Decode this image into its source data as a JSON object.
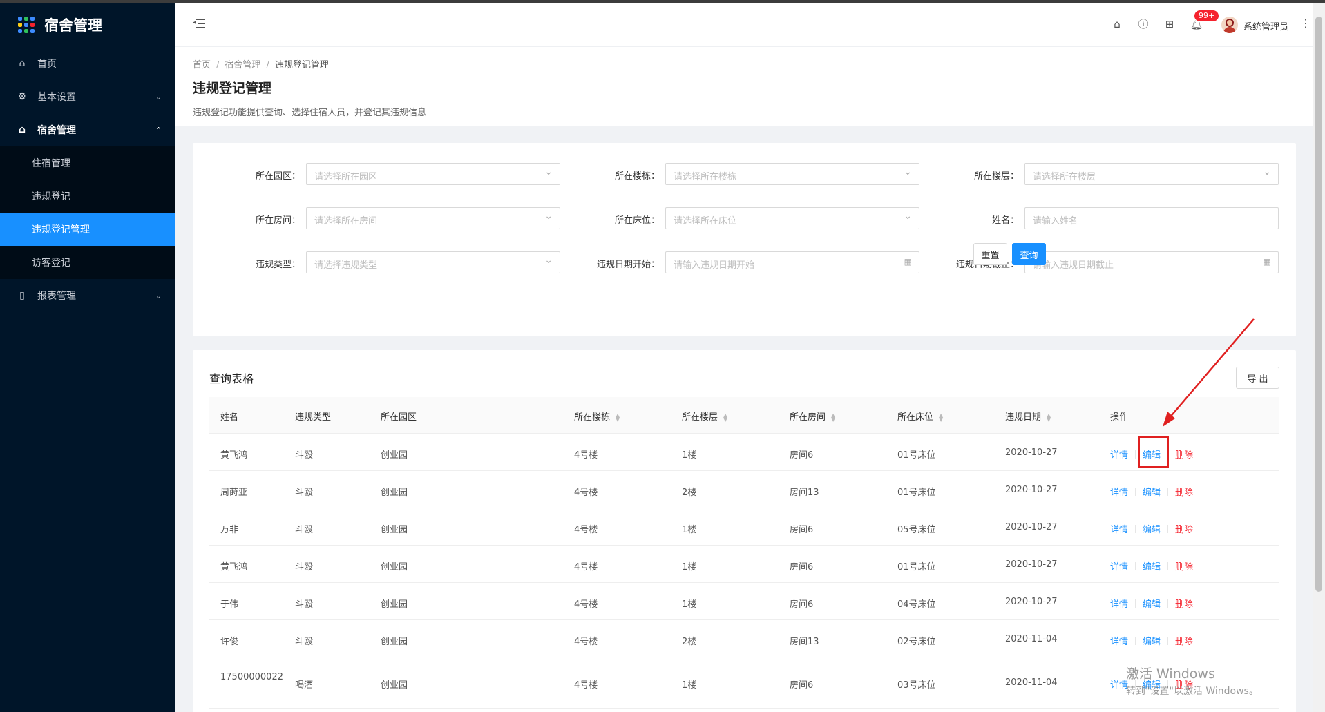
{
  "app": {
    "title": "宿舍管理"
  },
  "sidebar": {
    "items": [
      {
        "label": "首页",
        "icon": "home-icon"
      },
      {
        "label": "基本设置",
        "icon": "gear-icon"
      },
      {
        "label": "宿舍管理",
        "icon": "home-icon",
        "children": [
          {
            "label": "住宿管理"
          },
          {
            "label": "违规登记"
          },
          {
            "label": "违规登记管理",
            "active": true
          },
          {
            "label": "访客登记"
          }
        ]
      },
      {
        "label": "报表管理",
        "icon": "document-icon"
      }
    ]
  },
  "header": {
    "notification_count": "99+",
    "username": "系统管理员"
  },
  "breadcrumb": [
    "首页",
    "宿舍管理",
    "违规登记管理"
  ],
  "page": {
    "title": "违规登记管理",
    "description": "违规登记功能提供查询、选择住宿人员，并登记其违规信息"
  },
  "search": {
    "fields": [
      {
        "label": "所在园区：",
        "placeholder": "请选择所在园区",
        "type": "select"
      },
      {
        "label": "所在楼栋：",
        "placeholder": "请选择所在楼栋",
        "type": "select"
      },
      {
        "label": "所在楼层：",
        "placeholder": "请选择所在楼层",
        "type": "select"
      },
      {
        "label": "所在房间：",
        "placeholder": "请选择所在房间",
        "type": "select"
      },
      {
        "label": "所在床位：",
        "placeholder": "请选择所在床位",
        "type": "select"
      },
      {
        "label": "姓名：",
        "placeholder": "请输入姓名",
        "type": "text"
      },
      {
        "label": "违规类型：",
        "placeholder": "请选择违规类型",
        "type": "select"
      },
      {
        "label": "违规日期开始：",
        "placeholder": "请输入违规日期开始",
        "type": "date"
      },
      {
        "label": "违规日期截止：",
        "placeholder": "请输入违规日期截止",
        "type": "date"
      }
    ],
    "reset_label": "重置",
    "query_label": "查询"
  },
  "table": {
    "title": "查询表格",
    "export_label": "导 出",
    "columns": [
      "姓名",
      "违规类型",
      "所在园区",
      "所在楼栋",
      "所在楼层",
      "所在房间",
      "所在床位",
      "违规日期",
      "操作"
    ],
    "actions": {
      "detail": "详情",
      "edit": "编辑",
      "delete": "删除"
    },
    "rows": [
      [
        "黄飞鸿",
        "斗殴",
        "创业园",
        "4号楼",
        "1楼",
        "房间6",
        "01号床位",
        "2020-10-27"
      ],
      [
        "周莳亚",
        "斗殴",
        "创业园",
        "4号楼",
        "2楼",
        "房间13",
        "01号床位",
        "2020-10-27"
      ],
      [
        "万非",
        "斗殴",
        "创业园",
        "4号楼",
        "1楼",
        "房间6",
        "05号床位",
        "2020-10-27"
      ],
      [
        "黄飞鸿",
        "斗殴",
        "创业园",
        "4号楼",
        "1楼",
        "房间6",
        "01号床位",
        "2020-10-27"
      ],
      [
        "于伟",
        "斗殴",
        "创业园",
        "4号楼",
        "1楼",
        "房间6",
        "04号床位",
        "2020-10-27"
      ],
      [
        "许俊",
        "斗殴",
        "创业园",
        "4号楼",
        "2楼",
        "房间13",
        "02号床位",
        "2020-11-04"
      ],
      [
        "17500000022",
        "喝酒",
        "创业园",
        "4号楼",
        "1楼",
        "房间6",
        "03号床位",
        "2020-11-04"
      ]
    ]
  },
  "watermark": {
    "line1": "激活 Windows",
    "line2": "转到\"设置\"以激活 Windows。"
  },
  "colors": {
    "sidebar_bg": "#001529",
    "accent": "#1890ff",
    "danger": "#f5222d",
    "highlight": "#e02020"
  }
}
